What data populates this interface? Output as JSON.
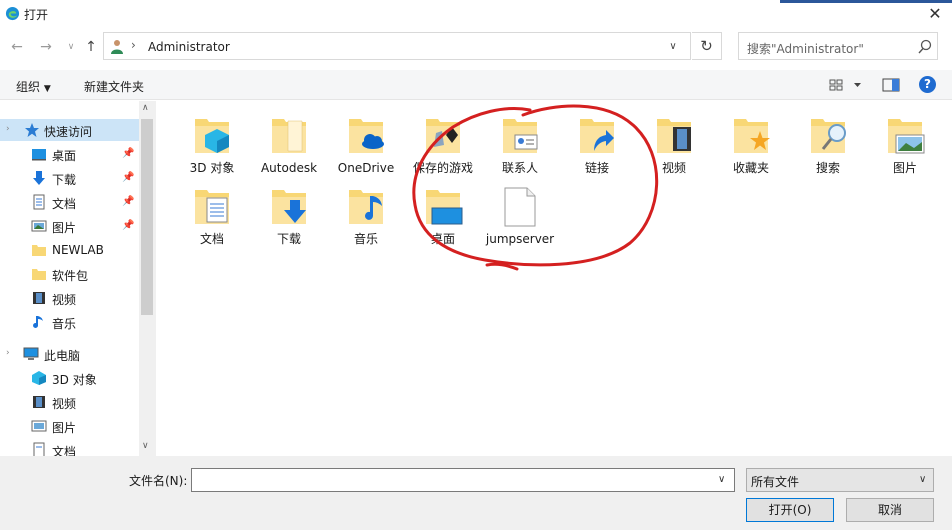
{
  "window": {
    "title": "打开"
  },
  "address": {
    "path": "Administrator",
    "search_placeholder": "搜索\"Administrator\""
  },
  "toolbar": {
    "organize_label": "组织",
    "new_folder_label": "新建文件夹"
  },
  "nav": {
    "quick_access": "快速访问",
    "quick_items": [
      "桌面",
      "下载",
      "文档",
      "图片",
      "NEWLAB",
      "软件包",
      "视频",
      "音乐"
    ],
    "this_pc": "此电脑",
    "pc_items": [
      "3D 对象",
      "视频",
      "图片",
      "文档"
    ]
  },
  "files": [
    {
      "label": "3D 对象",
      "icon": "3d-objects-folder-icon"
    },
    {
      "label": "Autodesk",
      "icon": "folder-icon"
    },
    {
      "label": "OneDrive",
      "icon": "onedrive-folder-icon"
    },
    {
      "label": "保存的游戏",
      "icon": "saved-games-folder-icon"
    },
    {
      "label": "联系人",
      "icon": "contacts-folder-icon"
    },
    {
      "label": "链接",
      "icon": "links-folder-icon"
    },
    {
      "label": "视频",
      "icon": "videos-folder-icon"
    },
    {
      "label": "收藏夹",
      "icon": "favorites-folder-icon"
    },
    {
      "label": "搜索",
      "icon": "searches-folder-icon"
    },
    {
      "label": "图片",
      "icon": "pictures-folder-icon"
    },
    {
      "label": "文档",
      "icon": "documents-folder-icon"
    },
    {
      "label": "下载",
      "icon": "downloads-folder-icon"
    },
    {
      "label": "音乐",
      "icon": "music-folder-icon"
    },
    {
      "label": "桌面",
      "icon": "desktop-folder-icon"
    },
    {
      "label": "jumpserver",
      "icon": "blank-file-icon"
    }
  ],
  "bottom": {
    "filename_label": "文件名(N):",
    "filename_value": "",
    "filetype_value": "所有文件",
    "open_label": "打开(O)",
    "cancel_label": "取消"
  },
  "colors": {
    "accent": "#0078d7",
    "selection": "#cce4f7",
    "folder": "#f8d775",
    "annotation": "#d42020"
  }
}
